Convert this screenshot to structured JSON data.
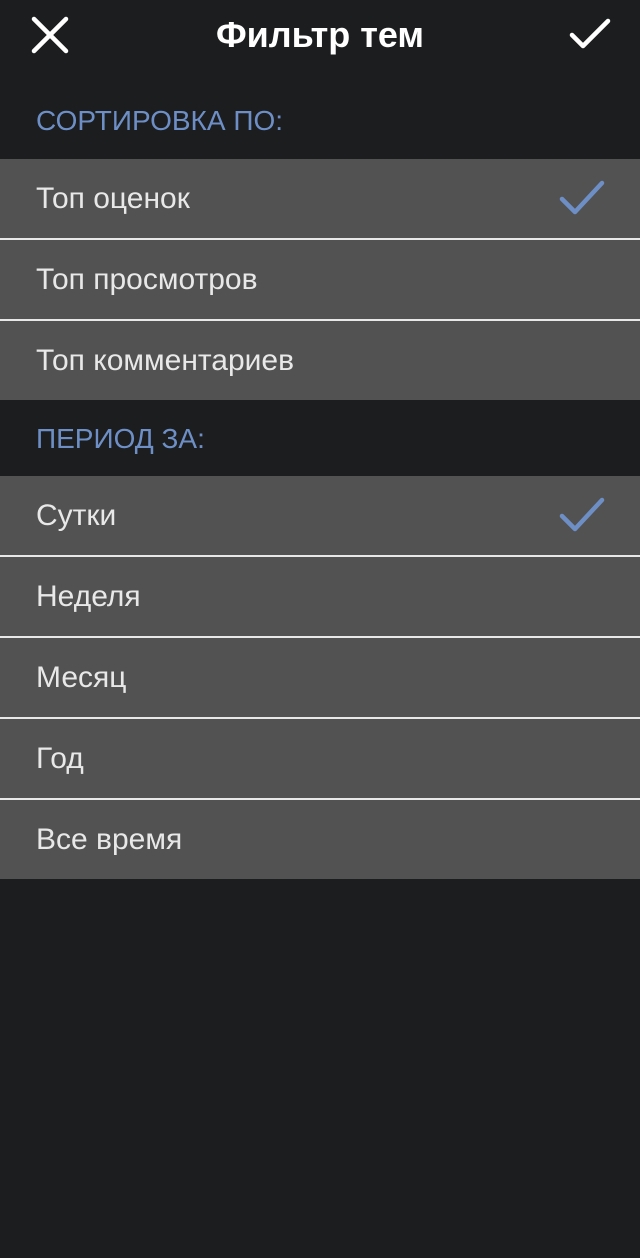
{
  "header": {
    "title": "Фильтр тем",
    "close_icon": "close-icon",
    "confirm_icon": "check-icon"
  },
  "sort_section": {
    "title": "СОРТИРОВКА ПО:",
    "items": [
      {
        "label": "Топ оценок",
        "selected": true
      },
      {
        "label": "Топ просмотров",
        "selected": false
      },
      {
        "label": "Топ комментариев",
        "selected": false
      }
    ]
  },
  "period_section": {
    "title": "ПЕРИОД ЗА:",
    "items": [
      {
        "label": "Сутки",
        "selected": true
      },
      {
        "label": "Неделя",
        "selected": false
      },
      {
        "label": "Месяц",
        "selected": false
      },
      {
        "label": "Год",
        "selected": false
      },
      {
        "label": "Все время",
        "selected": false
      }
    ]
  },
  "colors": {
    "background": "#1c1d1f",
    "row": "#525252",
    "accent": "#6d8fc6",
    "text": "#e8e8e8"
  }
}
